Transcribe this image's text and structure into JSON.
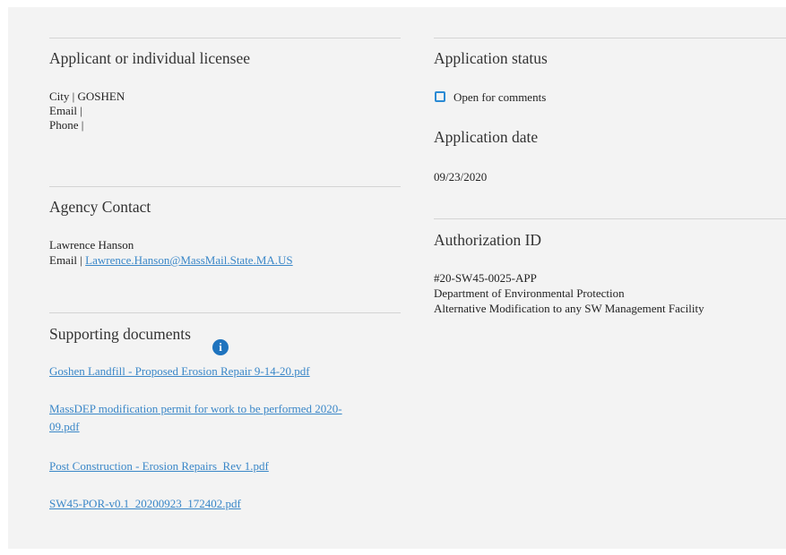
{
  "applicant": {
    "heading": "Applicant or individual licensee",
    "city": "City | GOSHEN",
    "email": "Email |",
    "phone": "Phone |"
  },
  "agency_contact": {
    "heading": "Agency Contact",
    "name": "Lawrence Hanson",
    "email_label": "Email | ",
    "email_link": "Lawrence.Hanson@MassMail.State.MA.US"
  },
  "supporting_documents": {
    "heading": "Supporting documents",
    "info_icon": "i",
    "documents": [
      "Goshen Landfill - Proposed Erosion Repair 9-14-20.pdf",
      "MassDEP modification permit for work to be performed 2020-",
      "09.pdf",
      "Post Construction - Erosion Repairs_Rev 1.pdf",
      "SW45-POR-v0.1_20200923_172402.pdf"
    ]
  },
  "application_status": {
    "heading": "Application status",
    "status_text": "Open for comments",
    "status_color": "#2a8ad4"
  },
  "application_date": {
    "heading": "Application date",
    "date": "09/23/2020"
  },
  "authorization": {
    "heading": "Authorization ID",
    "id": "#20-SW45-0025-APP",
    "department": "Department of Environmental Protection",
    "type": "Alternative Modification to any SW Management Facility"
  }
}
